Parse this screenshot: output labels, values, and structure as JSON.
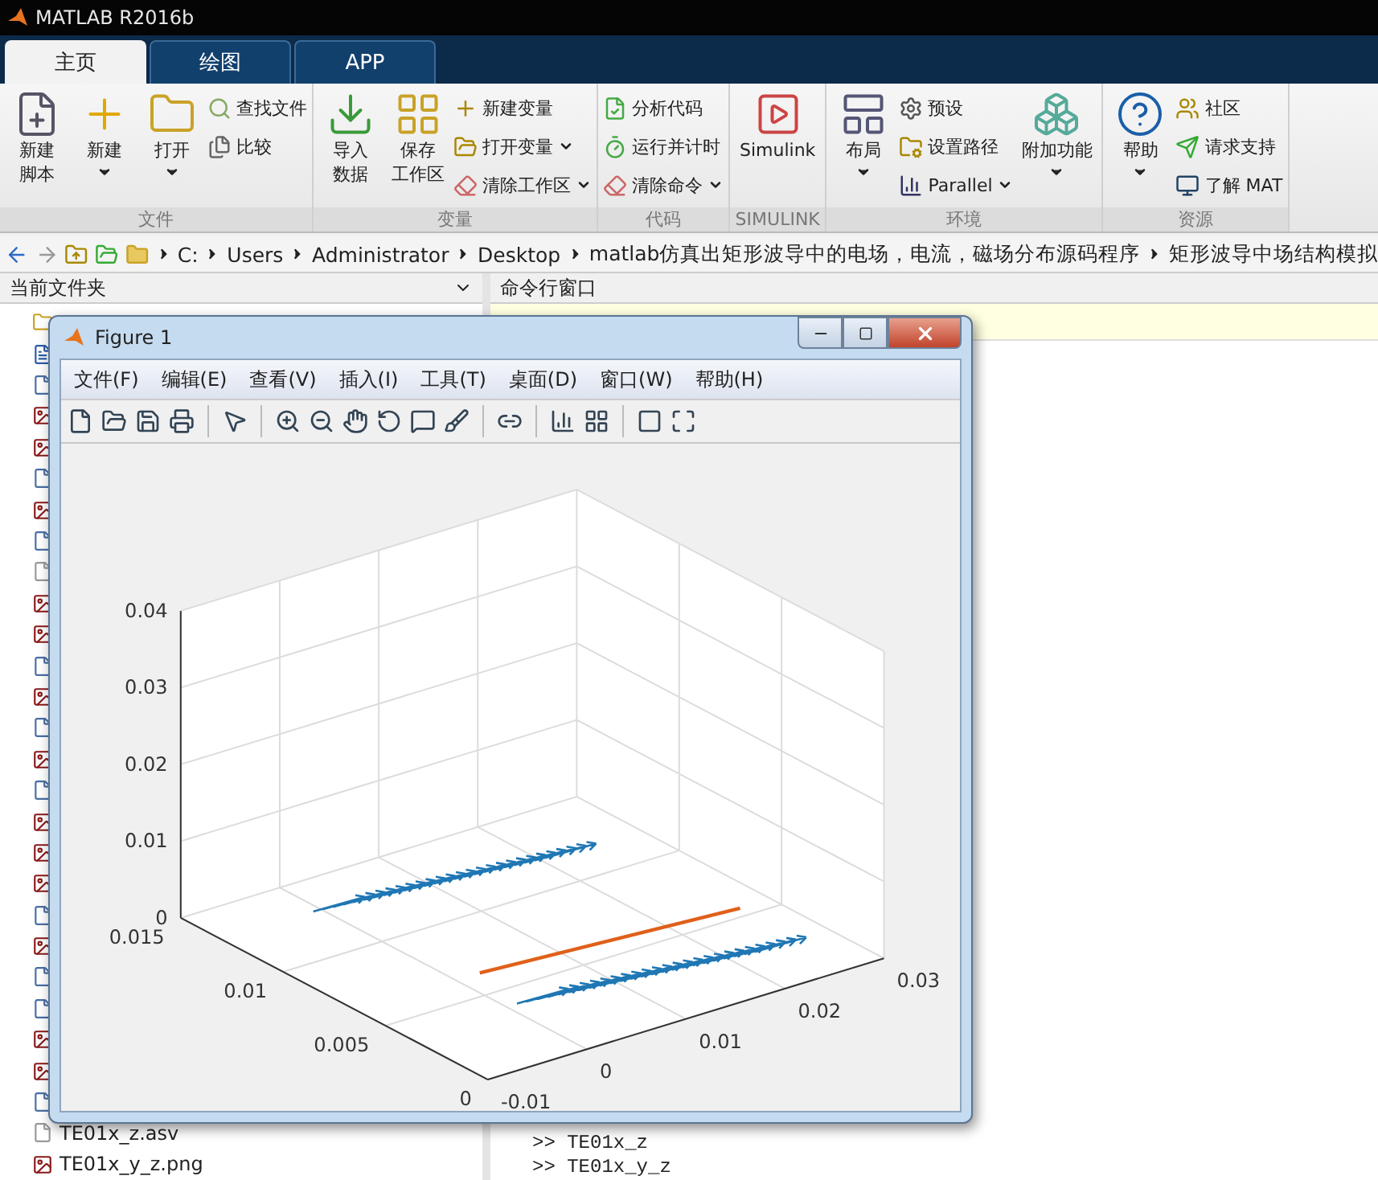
{
  "app": {
    "title": "MATLAB R2016b"
  },
  "tabs": [
    {
      "label": "主页",
      "selected": true
    },
    {
      "label": "绘图",
      "selected": false
    },
    {
      "label": "APP",
      "selected": false
    }
  ],
  "ribbon": [
    {
      "title": "文件",
      "items": [
        {
          "kind": "large",
          "lines": [
            "新建",
            "脚本"
          ],
          "menu": false
        },
        {
          "kind": "large",
          "lines": [
            "新建"
          ],
          "menu": true
        },
        {
          "kind": "large",
          "lines": [
            "打开"
          ],
          "menu": true
        },
        {
          "kind": "stack",
          "items": [
            {
              "label": "查找文件",
              "menu": false
            },
            {
              "label": "比较",
              "menu": false
            }
          ]
        }
      ]
    },
    {
      "title": "变量",
      "items": [
        {
          "kind": "large",
          "lines": [
            "导入",
            "数据"
          ],
          "menu": false
        },
        {
          "kind": "large",
          "lines": [
            "保存",
            "工作区"
          ],
          "menu": false
        },
        {
          "kind": "stack",
          "items": [
            {
              "label": "新建变量",
              "menu": false
            },
            {
              "label": "打开变量",
              "menu": true
            },
            {
              "label": "清除工作区",
              "menu": true
            }
          ]
        }
      ]
    },
    {
      "title": "代码",
      "items": [
        {
          "kind": "stack",
          "items": [
            {
              "label": "分析代码",
              "menu": false
            },
            {
              "label": "运行并计时",
              "menu": false
            },
            {
              "label": "清除命令",
              "menu": true
            }
          ]
        }
      ]
    },
    {
      "title": "SIMULINK",
      "items": [
        {
          "kind": "large",
          "lines": [
            "Simulink"
          ],
          "menu": false
        }
      ]
    },
    {
      "title": "环境",
      "items": [
        {
          "kind": "large",
          "lines": [
            "布局"
          ],
          "menu": true
        },
        {
          "kind": "stack",
          "items": [
            {
              "label": "预设",
              "menu": false
            },
            {
              "label": "设置路径",
              "menu": false
            },
            {
              "label": "Parallel",
              "menu": true
            }
          ]
        },
        {
          "kind": "large",
          "lines": [
            "附加功能"
          ],
          "menu": true
        }
      ]
    },
    {
      "title": "资源",
      "items": [
        {
          "kind": "large",
          "lines": [
            "帮助"
          ],
          "menu": true
        },
        {
          "kind": "stack",
          "items": [
            {
              "label": "社区",
              "menu": false
            },
            {
              "label": "请求支持",
              "menu": false
            },
            {
              "label": "了解 MAT",
              "menu": false
            }
          ]
        }
      ]
    }
  ],
  "address": [
    "C:",
    "Users",
    "Administrator",
    "Desktop",
    "matlab仿真出矩形波导中的电场，电流，磁场分布源码程序",
    "矩形波导中场结构模拟"
  ],
  "files_panel": {
    "title": "当前文件夹",
    "files": [
      {
        "kind": "folder"
      },
      {
        "kind": "doc"
      },
      {
        "kind": "script"
      },
      {
        "kind": "png"
      },
      {
        "kind": "png"
      },
      {
        "kind": "script"
      },
      {
        "kind": "png"
      },
      {
        "kind": "script"
      },
      {
        "kind": "asv"
      },
      {
        "kind": "png"
      },
      {
        "kind": "png"
      },
      {
        "kind": "script"
      },
      {
        "kind": "png"
      },
      {
        "kind": "script"
      },
      {
        "kind": "png"
      },
      {
        "kind": "script"
      },
      {
        "kind": "png"
      },
      {
        "kind": "png"
      },
      {
        "kind": "png"
      },
      {
        "kind": "script"
      },
      {
        "kind": "png"
      },
      {
        "kind": "script"
      },
      {
        "kind": "script"
      },
      {
        "kind": "png"
      },
      {
        "kind": "png"
      },
      {
        "kind": "script"
      },
      {
        "kind": "asv",
        "name": "TE01x_z.asv"
      },
      {
        "kind": "png",
        "name": "TE01x_y_z.png"
      }
    ]
  },
  "command_window": {
    "title": "命令行窗口",
    "lines": [
      {
        "prompt": ">>",
        "text": "TE01x_z"
      },
      {
        "prompt": ">>",
        "text": "TE01x_y_z"
      }
    ]
  },
  "figure": {
    "title": "Figure 1",
    "menus": [
      "文件(F)",
      "编辑(E)",
      "查看(V)",
      "插入(I)",
      "工具(T)",
      "桌面(D)",
      "窗口(W)",
      "帮助(H)"
    ],
    "plot": {
      "z_ticks": [
        "0.04",
        "0.03",
        "0.02",
        "0.01",
        "0"
      ],
      "y_ticks": [
        "0.015",
        "0.01",
        "0.005",
        "0"
      ],
      "x_ticks": [
        "-0.01",
        "0",
        "0.01",
        "0.02",
        "0.03"
      ]
    }
  }
}
